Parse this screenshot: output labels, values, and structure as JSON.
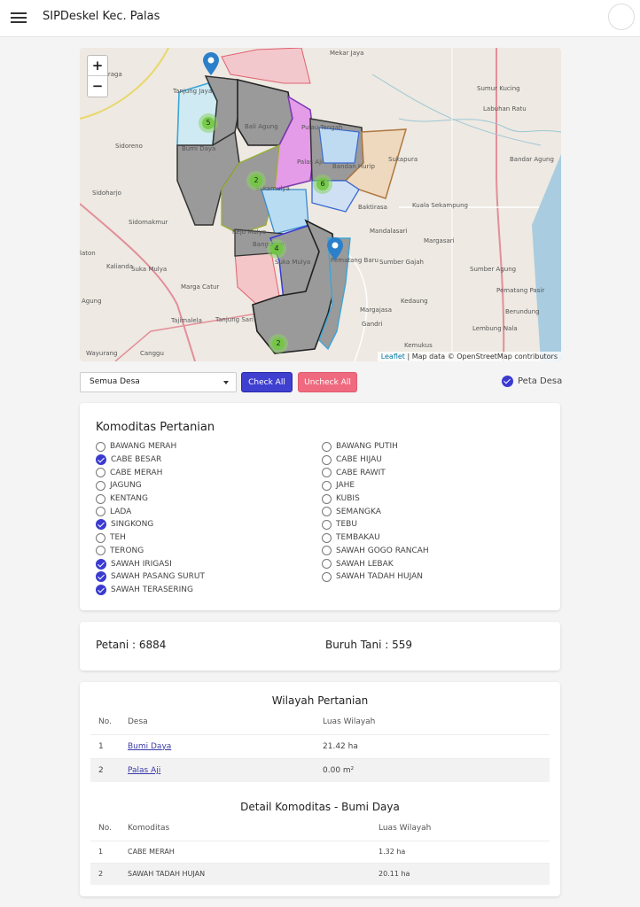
{
  "app": {
    "title": "SIPDeskel Kec. Palas"
  },
  "map": {
    "zoom_in": "+",
    "zoom_out": "−",
    "attribution_link": "Leaflet",
    "attribution_text": " | Map data © OpenStreetMap contributors",
    "labels": [
      {
        "text": "Mekar Jaya"
      },
      {
        "text": "Balinuraga"
      },
      {
        "text": "Tanjung Jaya"
      },
      {
        "text": "Sumur Kucing"
      },
      {
        "text": "Labuhan Ratu"
      },
      {
        "text": "Bali Agung"
      },
      {
        "text": "Pulau Tengah"
      },
      {
        "text": "Sidoreno"
      },
      {
        "text": "Bumi Daya"
      },
      {
        "text": "Palas Aji"
      },
      {
        "text": "Bandan Hurip"
      },
      {
        "text": "Sukapura"
      },
      {
        "text": "Bandar Agung"
      },
      {
        "text": "Sidoharjo"
      },
      {
        "text": "Sukamulya"
      },
      {
        "text": "Baktirasa"
      },
      {
        "text": "Kuala Sekampung"
      },
      {
        "text": "Sidomakmur"
      },
      {
        "text": "Rejo Mulyo"
      },
      {
        "text": "Mandalasari"
      },
      {
        "text": "Margasari"
      },
      {
        "text": "Bangunan"
      },
      {
        "text": "Suka Mulya"
      },
      {
        "text": "Sumber Gajah"
      },
      {
        "text": "Sumber Agung"
      },
      {
        "text": "Suka Mulya"
      },
      {
        "text": "Pematang Baru"
      },
      {
        "text": "Kalianda"
      },
      {
        "text": "Marga Catur"
      },
      {
        "text": "Pematang Pasir"
      },
      {
        "text": "Agung"
      },
      {
        "text": "Kedaung"
      },
      {
        "text": "Margajasa"
      },
      {
        "text": "Berundung"
      },
      {
        "text": "Tajimalela"
      },
      {
        "text": "Tanjung Sari"
      },
      {
        "text": "Gandri"
      },
      {
        "text": "Lembung Nala"
      },
      {
        "text": "Kemukus"
      },
      {
        "text": "Wayurang"
      },
      {
        "text": "Canggu"
      },
      {
        "text": "laton"
      }
    ],
    "clusters": [
      {
        "count": "5"
      },
      {
        "count": "2"
      },
      {
        "count": "6"
      },
      {
        "count": "4"
      },
      {
        "count": "2"
      }
    ]
  },
  "controls": {
    "desa_select": "Semua Desa",
    "check_all": "Check All",
    "uncheck_all": "Uncheck All",
    "peta_desa": "Peta Desa"
  },
  "komoditas": {
    "title": "Komoditas Pertanian",
    "left": [
      {
        "label": "BAWANG MERAH",
        "checked": false
      },
      {
        "label": "CABE BESAR",
        "checked": true
      },
      {
        "label": "CABE MERAH",
        "checked": false
      },
      {
        "label": "JAGUNG",
        "checked": false
      },
      {
        "label": "KENTANG",
        "checked": false
      },
      {
        "label": "LADA",
        "checked": false
      },
      {
        "label": "SINGKONG",
        "checked": true
      },
      {
        "label": "TEH",
        "checked": false
      },
      {
        "label": "TERONG",
        "checked": false
      },
      {
        "label": "SAWAH IRIGASI",
        "checked": true
      },
      {
        "label": "SAWAH PASANG SURUT",
        "checked": true
      },
      {
        "label": "SAWAH TERASERING",
        "checked": true
      }
    ],
    "right": [
      {
        "label": "BAWANG PUTIH",
        "checked": false
      },
      {
        "label": "CABE HIJAU",
        "checked": false
      },
      {
        "label": "CABE RAWIT",
        "checked": false
      },
      {
        "label": "JAHE",
        "checked": false
      },
      {
        "label": "KUBIS",
        "checked": false
      },
      {
        "label": "SEMANGKA",
        "checked": false
      },
      {
        "label": "TEBU",
        "checked": false
      },
      {
        "label": "TEMBAKAU",
        "checked": false
      },
      {
        "label": "SAWAH GOGO RANCAH",
        "checked": false
      },
      {
        "label": "SAWAH LEBAK",
        "checked": false
      },
      {
        "label": "SAWAH TADAH HUJAN",
        "checked": false
      }
    ]
  },
  "stats": {
    "petani": "Petani : 6884",
    "buruh": "Buruh Tani : 559"
  },
  "wilayah": {
    "title": "Wilayah Pertanian",
    "headers": [
      "No.",
      "Desa",
      "Luas Wilayah"
    ],
    "rows": [
      {
        "no": "1",
        "desa": "Bumi Daya",
        "luas": "21.42 ha"
      },
      {
        "no": "2",
        "desa": "Palas Aji",
        "luas": "0.00 m²"
      }
    ]
  },
  "detail": {
    "title": "Detail Komoditas - Bumi Daya",
    "headers": [
      "No.",
      "Komoditas",
      "Luas Wilayah"
    ],
    "rows": [
      {
        "no": "1",
        "komoditas": "CABE MERAH",
        "luas": "1.32 ha"
      },
      {
        "no": "2",
        "komoditas": "SAWAH TADAH HUJAN",
        "luas": "20.11 ha"
      }
    ]
  },
  "colors": {
    "primary": "#3f3fd0",
    "danger": "#ef6a7e",
    "link": "#3a3aa8"
  }
}
